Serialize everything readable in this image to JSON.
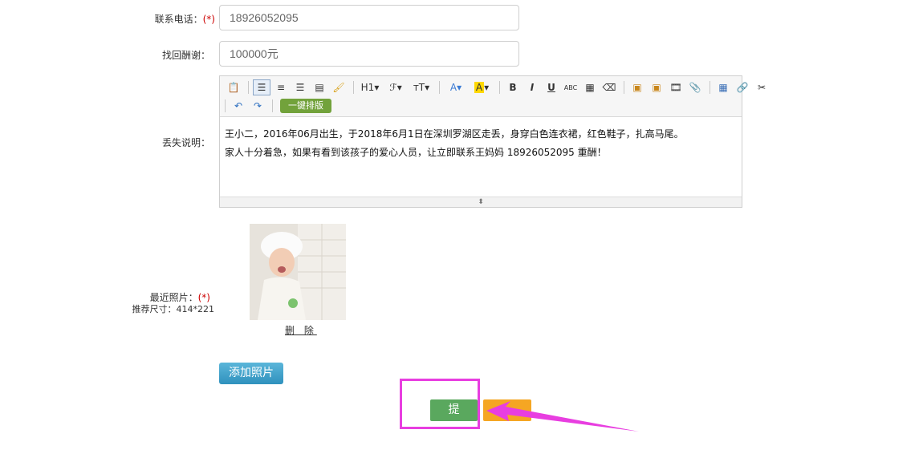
{
  "form": {
    "phone": {
      "label": "联系电话：",
      "required_mark": "(*)",
      "value": "18926052095"
    },
    "reward": {
      "label": "找回酬谢：",
      "value": "100000元"
    },
    "description": {
      "label": "丢失说明：",
      "line1": "王小二，2016年06月出生，于2018年6月1日在深圳罗湖区走丢，身穿白色连衣裙，红色鞋子，扎高马尾。",
      "line2": "家人十分着急，如果有看到该孩子的爱心人员，让立即联系王妈妈 18926052095 重酬！"
    },
    "photo": {
      "label": "最近照片：",
      "required_mark": "(*)",
      "size_hint": "推荐尺寸：414*221",
      "delete_label": "删 除"
    },
    "add_photo_label": "添加照片",
    "submit_label": "提 交"
  },
  "toolbar": {
    "h1": "H1",
    "font": "ℱ",
    "size": "тT",
    "bold": "B",
    "italic": "I",
    "underline": "U",
    "strike": "ABC",
    "one_key_layout": "一键排版"
  },
  "colors": {
    "highlight": "#e83ee0",
    "submit": "#5aa85e",
    "orange": "#f5a623",
    "add_photo": "#3fa3cd",
    "one_key": "#72a23b"
  }
}
